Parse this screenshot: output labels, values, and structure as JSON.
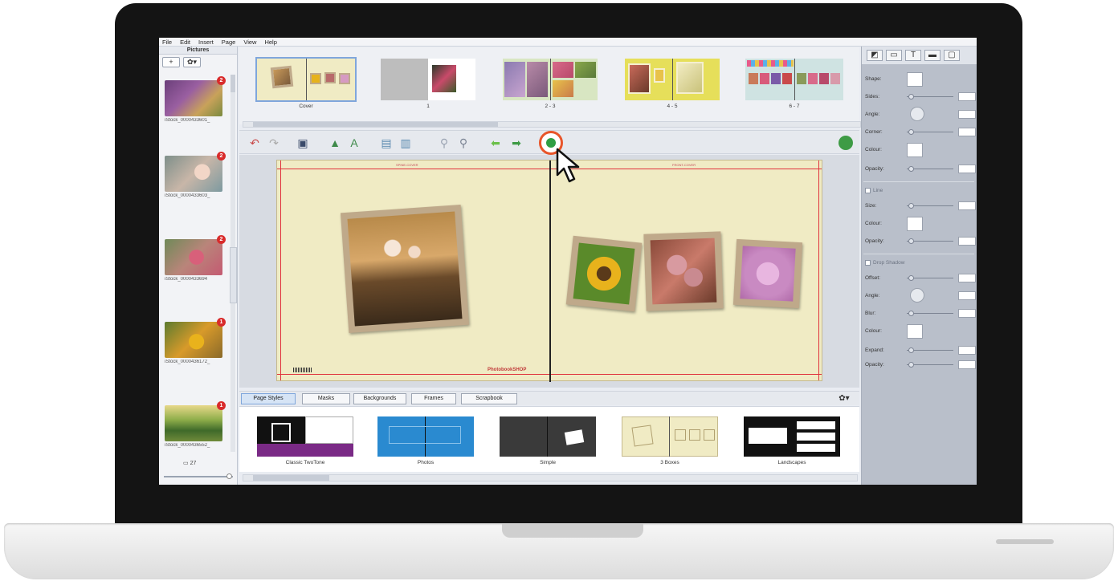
{
  "menu": [
    "File",
    "Edit",
    "Insert",
    "Page",
    "View",
    "Help"
  ],
  "pictures_panel": {
    "title": "Pictures",
    "add_label": "+",
    "options_label": "✿▾",
    "count": "27",
    "items": [
      {
        "label": "iStock_0000433601_",
        "badge": "2"
      },
      {
        "label": "iStock_0000433603_",
        "badge": "2"
      },
      {
        "label": "iStock_0000433694",
        "badge": "2"
      },
      {
        "label": "iStock_0000436172_",
        "badge": "1"
      },
      {
        "label": "iStock_0000436552_",
        "badge": "1"
      }
    ]
  },
  "pages": [
    {
      "label": "Cover"
    },
    {
      "label": "1"
    },
    {
      "label": "2 - 3"
    },
    {
      "label": "4 - 5"
    },
    {
      "label": "6 - 7"
    }
  ],
  "toolbar": {
    "icons": [
      "undo-icon",
      "redo-icon",
      "save-icon",
      "add-picture-icon",
      "add-text-icon",
      "add-page-icon",
      "remove-page-icon",
      "zoom-out-icon",
      "zoom-in-icon",
      "back-arrow-icon",
      "forward-arrow-icon",
      "help-icon",
      "cart-icon"
    ]
  },
  "spread": {
    "left_header": "SPINE-COVER",
    "right_header": "FRONT-COVER",
    "brand": "PhotobookSHOP"
  },
  "tabs": [
    "Page Styles",
    "Masks",
    "Backgrounds",
    "Frames",
    "Scrapbook"
  ],
  "tabs_gear": "✿▾",
  "styles": [
    {
      "label": "Classic TwoTone"
    },
    {
      "label": "Photos"
    },
    {
      "label": "Simple"
    },
    {
      "label": "3 Boxes"
    },
    {
      "label": "Landscapes"
    }
  ],
  "properties": {
    "tabs": [
      "◩",
      "▭",
      "T",
      "▬",
      "▢"
    ],
    "shape_label": "Shape:",
    "sides_label": "Sides:",
    "angle_label": "Angle:",
    "corner_label": "Corner:",
    "colour_label": "Colour:",
    "opacity_label": "Opacity:",
    "line_label": "Line",
    "size_label": "Size:",
    "line_colour_label": "Colour:",
    "line_opacity_label": "Opacity:",
    "drop_shadow_label": "Drop Shadow",
    "offset_label": "Offset:",
    "shadow_angle_label": "Angle:",
    "blur_label": "Blur:",
    "shadow_colour_label": "Colour:",
    "expand_label": "Expand:",
    "shadow_opacity_label": "Opacity:"
  },
  "colors": {
    "accent_highlight": "#e8552a",
    "bleed_line": "#e0323d",
    "page_background": "#f0ebc4",
    "badge": "#d92b2b"
  }
}
